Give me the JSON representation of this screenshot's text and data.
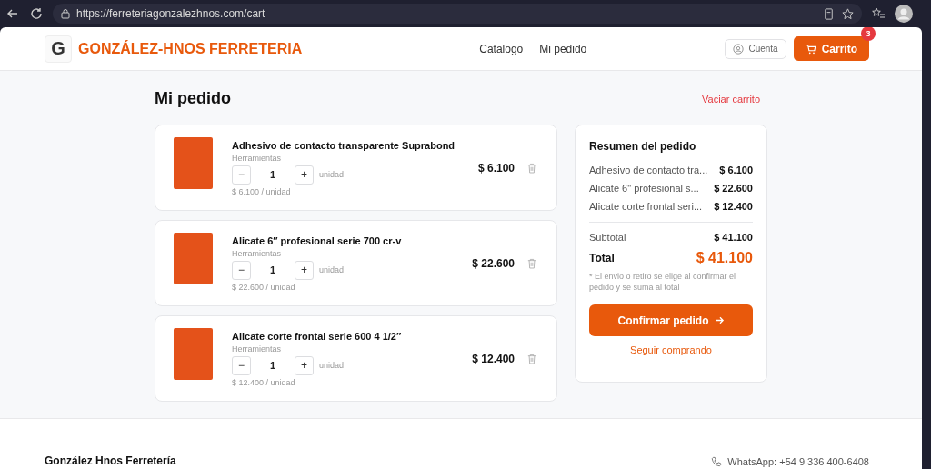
{
  "browser": {
    "url": "https://ferreteriagonzalezhnos.com/cart"
  },
  "header": {
    "logo_letter": "G",
    "brand": "GONZÁLEZ-HNOS FERRETERIA",
    "nav": [
      "Catalogo",
      "Mi pedido"
    ],
    "account": "Cuenta",
    "cart": {
      "label": "Carrito",
      "count": "3"
    }
  },
  "page": {
    "title": "Mi pedido",
    "clear": "Vaciar carrito"
  },
  "items": [
    {
      "name": "Adhesivo de contacto transparente Suprabond",
      "category": "Herramientas",
      "decrease": "−",
      "qty": "1",
      "increase": "+",
      "unit": "unidad",
      "total": "$ 6.100",
      "unit_price": "$ 6.100 / unidad"
    },
    {
      "name": "Alicate 6″ profesional serie 700 cr-v",
      "category": "Herramientas",
      "decrease": "−",
      "qty": "1",
      "increase": "+",
      "unit": "unidad",
      "total": "$ 22.600",
      "unit_price": "$ 22.600 / unidad"
    },
    {
      "name": "Alicate corte frontal serie 600 4 1/2″",
      "category": "Herramientas",
      "decrease": "−",
      "qty": "1",
      "increase": "+",
      "unit": "unidad",
      "total": "$ 12.400",
      "unit_price": "$ 12.400 / unidad"
    }
  ],
  "summary": {
    "title": "Resumen del pedido",
    "lines": [
      {
        "name": "Adhesivo de contacto tra...",
        "amount": "$ 6.100"
      },
      {
        "name": "Alicate 6\" profesional s...",
        "amount": "$ 22.600"
      },
      {
        "name": "Alicate corte frontal seri...",
        "amount": "$ 12.400"
      }
    ],
    "subtotal_label": "Subtotal",
    "subtotal": "$ 41.100",
    "total_label": "Total",
    "total": "$ 41.100",
    "note": "* El envio o retiro se elige al confirmar el pedido y se suma al total",
    "confirm": "Confirmar pedido",
    "continue": "Seguir comprando"
  },
  "footer": {
    "brand": "González Hnos Ferretería",
    "whatsapp": "WhatsApp: +54 9 336 400-6408"
  }
}
